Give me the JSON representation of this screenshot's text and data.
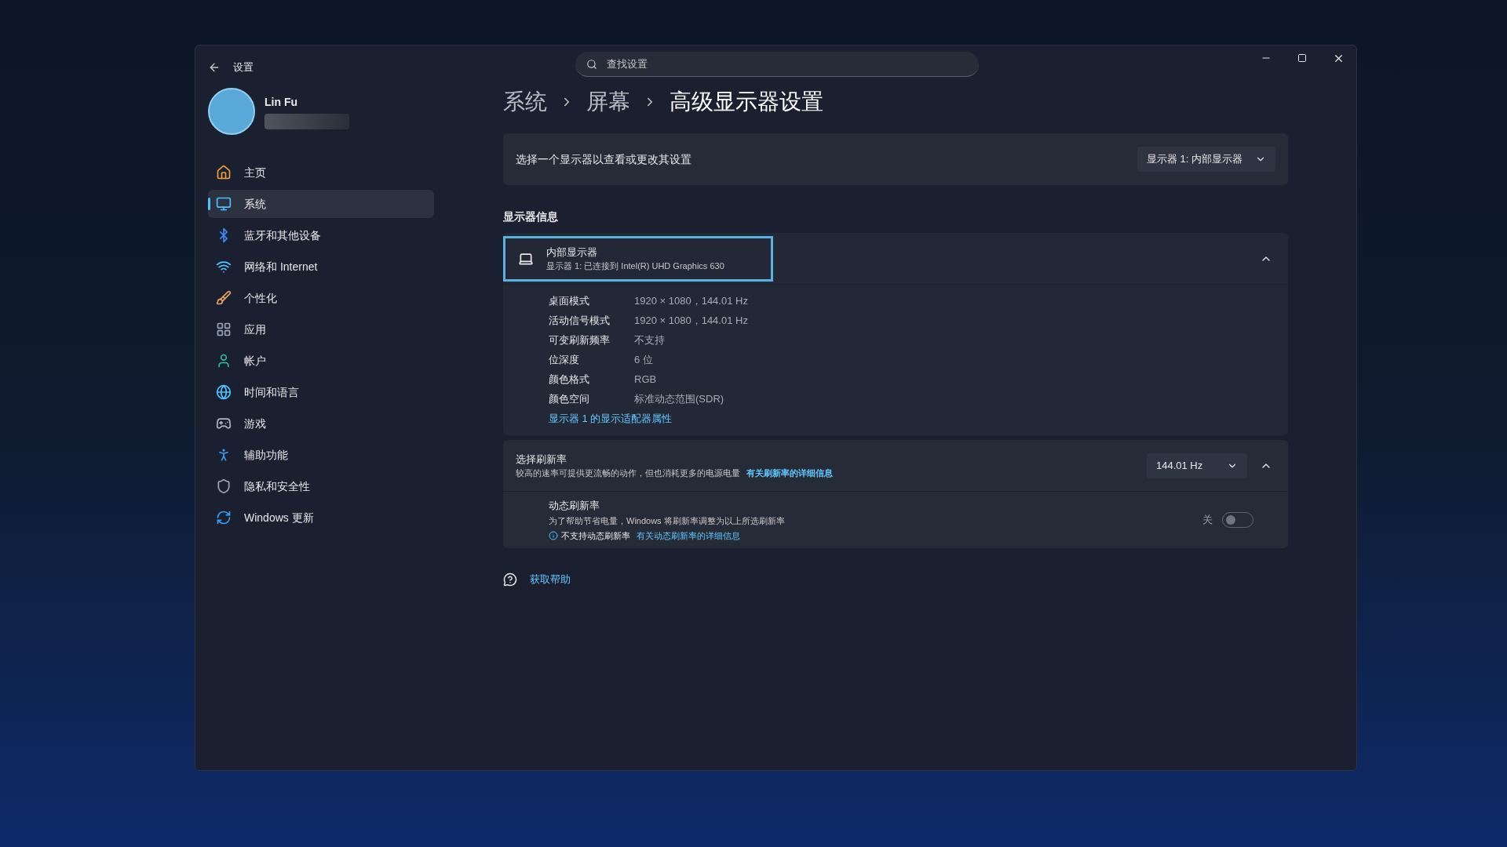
{
  "window": {
    "title": "设置"
  },
  "search": {
    "placeholder": "查找设置"
  },
  "user": {
    "name": "Lin Fu"
  },
  "sidebar": {
    "items": [
      {
        "kind": "home",
        "label": "主页",
        "selected": false
      },
      {
        "kind": "system",
        "label": "系统",
        "selected": true
      },
      {
        "kind": "bluetooth",
        "label": "蓝牙和其他设备",
        "selected": false
      },
      {
        "kind": "network",
        "label": "网络和 Internet",
        "selected": false
      },
      {
        "kind": "personalize",
        "label": "个性化",
        "selected": false
      },
      {
        "kind": "apps",
        "label": "应用",
        "selected": false
      },
      {
        "kind": "account",
        "label": "帐户",
        "selected": false
      },
      {
        "kind": "time",
        "label": "时间和语言",
        "selected": false
      },
      {
        "kind": "gaming",
        "label": "游戏",
        "selected": false
      },
      {
        "kind": "accessibility",
        "label": "辅助功能",
        "selected": false
      },
      {
        "kind": "privacy",
        "label": "隐私和安全性",
        "selected": false
      },
      {
        "kind": "update",
        "label": "Windows 更新",
        "selected": false
      }
    ]
  },
  "breadcrumb": [
    "系统",
    "屏幕",
    "高级显示器设置"
  ],
  "display_select": {
    "label": "选择一个显示器以查看或更改其设置",
    "value": "显示器 1: 内部显示器"
  },
  "section_title": "显示器信息",
  "display_info": {
    "name": "内部显示器",
    "subtitle": "显示器 1: 已连接到 Intel(R) UHD Graphics 630",
    "focused": true,
    "expanded": true,
    "properties": [
      {
        "label": "桌面模式",
        "value": "1920 × 1080，144.01 Hz"
      },
      {
        "label": "活动信号模式",
        "value": "1920 × 1080，144.01 Hz"
      },
      {
        "label": "可变刷新频率",
        "value": "不支持"
      },
      {
        "label": "位深度",
        "value": "6 位"
      },
      {
        "label": "颜色格式",
        "value": "RGB"
      },
      {
        "label": "颜色空间",
        "value": "标准动态范围(SDR)"
      }
    ],
    "link": "显示器 1 的显示适配器属性"
  },
  "refresh": {
    "title": "选择刷新率",
    "description": "较高的速率可提供更流畅的动作，但也消耗更多的电源电量",
    "link": "有关刷新率的详细信息",
    "value": "144.01 Hz",
    "expanded": true,
    "dynamic": {
      "title": "动态刷新率",
      "description": "为了帮助节省电量，Windows 将刷新率调整为以上所选刷新率",
      "note": "不支持动态刷新率",
      "link": "有关动态刷新率的详细信息",
      "state_label": "关",
      "on": false
    }
  },
  "help": "获取帮助"
}
